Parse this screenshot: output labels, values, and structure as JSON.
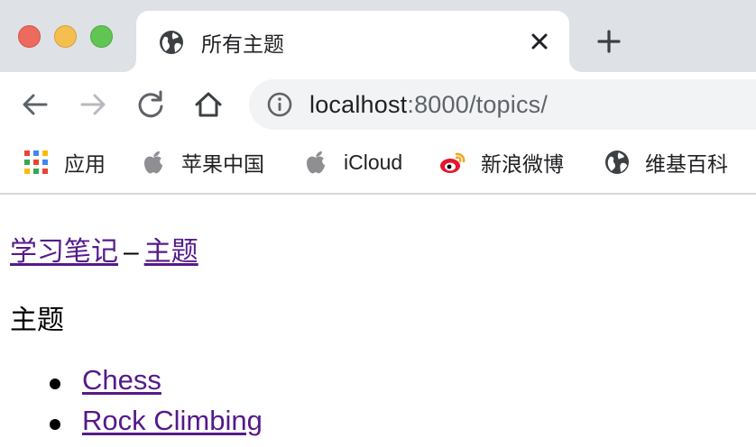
{
  "window": {
    "traffic_lights": [
      "close",
      "minimize",
      "maximize"
    ]
  },
  "tab": {
    "title": "所有主题",
    "favicon": "globe-icon",
    "close_icon": "close-icon"
  },
  "new_tab_icon": "plus-icon",
  "toolbar": {
    "back_icon": "back-arrow-icon",
    "forward_icon": "forward-arrow-icon",
    "reload_icon": "reload-icon",
    "home_icon": "home-icon",
    "site_info_icon": "info-icon",
    "url_host": "localhost",
    "url_rest": ":8000/topics/"
  },
  "bookmarks": [
    {
      "label": "应用",
      "icon": "apps-grid-icon"
    },
    {
      "label": "苹果中国",
      "icon": "apple-icon"
    },
    {
      "label": "iCloud",
      "icon": "apple-icon"
    },
    {
      "label": "新浪微博",
      "icon": "weibo-icon"
    },
    {
      "label": "维基百科",
      "icon": "globe-icon"
    }
  ],
  "page": {
    "nav": {
      "home_link": "学习笔记",
      "separator": "–",
      "topics_link": "主题"
    },
    "heading": "主题",
    "topics": [
      "Chess",
      "Rock Climbing"
    ]
  },
  "colors": {
    "tab_strip": "#dee1e6",
    "omnibox": "#f1f3f4",
    "visited_link": "#551a8b",
    "traffic_red": "#ed6a5e",
    "traffic_yellow": "#f4bf4f",
    "traffic_green": "#61c554"
  }
}
